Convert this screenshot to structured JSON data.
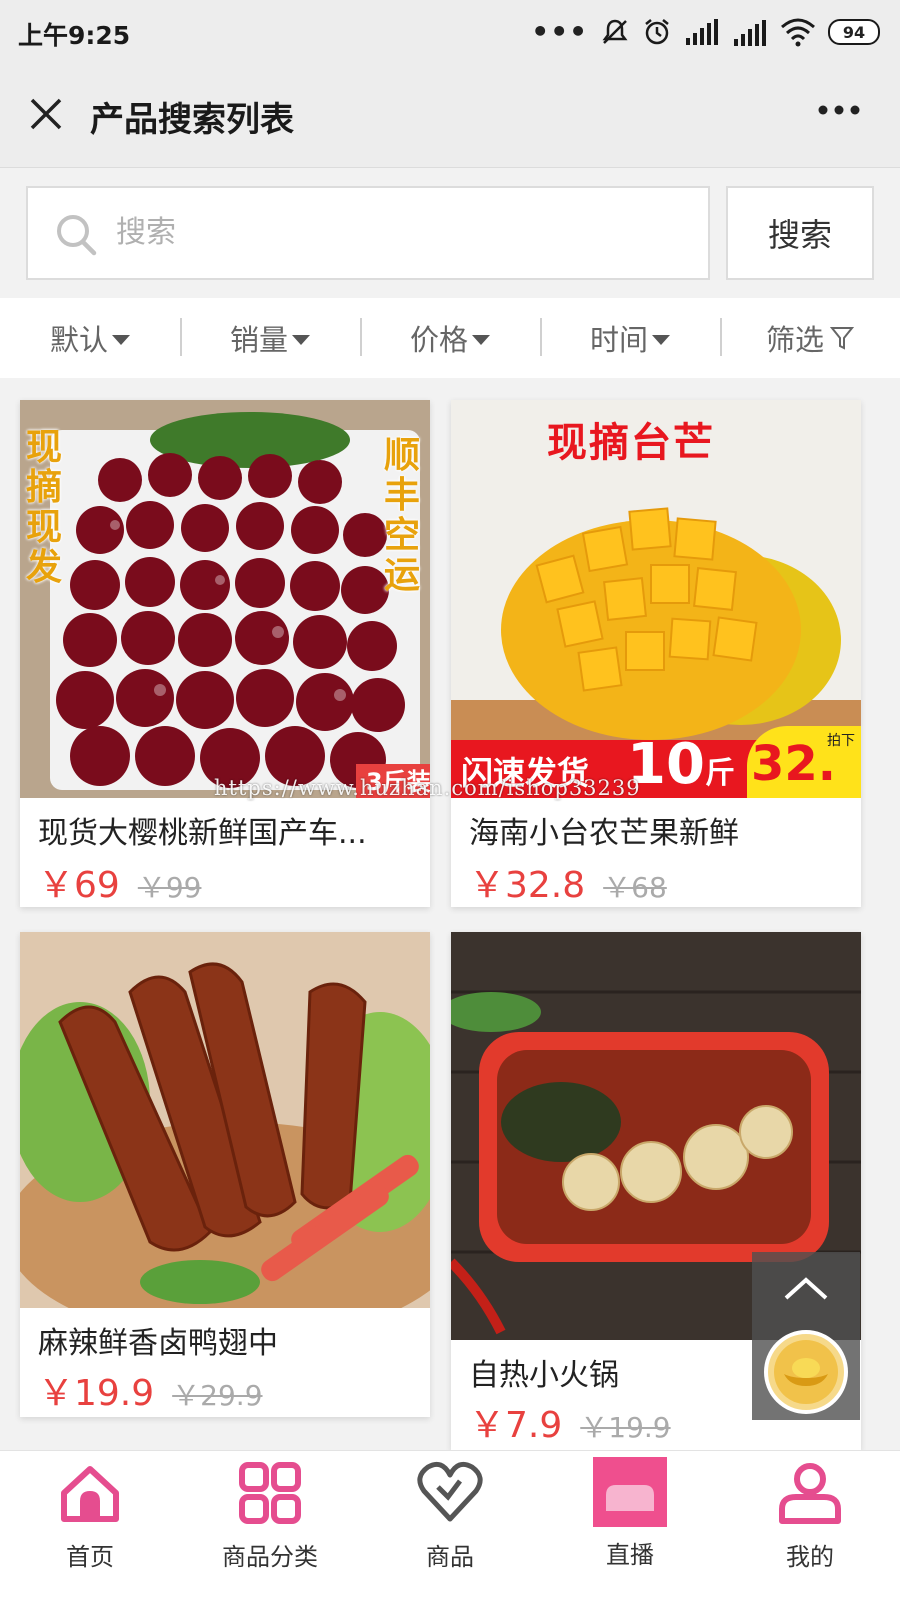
{
  "status": {
    "time": "上午9:25",
    "battery": "94"
  },
  "navbar": {
    "title": "产品搜索列表"
  },
  "search": {
    "placeholder": "搜索",
    "button_label": "搜索"
  },
  "sort": [
    "默认",
    "销量",
    "价格",
    "时间",
    "筛选"
  ],
  "products": [
    {
      "title": "现货大樱桃新鲜国产车...",
      "price": "￥69",
      "old_price": "￥99",
      "banner_left": "现摘现发",
      "banner_right": "顺丰空运",
      "bottom_text": "3斤装"
    },
    {
      "title": "海南小台农芒果新鲜",
      "price": "￥32.8",
      "old_price": "￥68",
      "banner_top": "现摘台芒",
      "badge_left": "闪速发货",
      "badge_mid": "10",
      "badge_unit": "斤",
      "badge_price": "32.",
      "badge_small": "拍下"
    },
    {
      "title": "麻辣鲜香卤鸭翅中",
      "price": "￥19.9",
      "old_price": "￥29.9"
    },
    {
      "title": "自热小火锅",
      "price": "￥7.9",
      "old_price": "￥19.9"
    }
  ],
  "watermark": "https://www.huzhan.com/ishop33239",
  "tabs": [
    "首页",
    "商品分类",
    "商品",
    "直播",
    "我的"
  ],
  "colors": {
    "accent": "#e8413f",
    "tab_pink": "#e54d8f",
    "live_pink": "#ef4f8e"
  }
}
